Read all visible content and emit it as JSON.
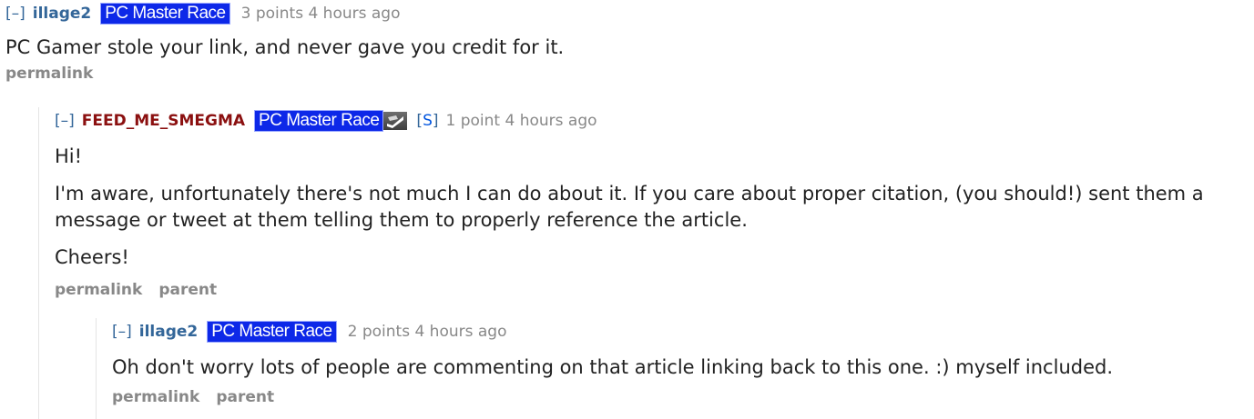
{
  "comments": [
    {
      "collapse": "[–]",
      "author": "illage2",
      "flair": "PC Master Race",
      "meta": "3 points 4 hours ago",
      "body": [
        "PC Gamer stole your link, and never gave you credit for it."
      ],
      "buttons": [
        "permalink"
      ]
    },
    {
      "collapse": "[–]",
      "author": "FEED_ME_SMEGMA",
      "flair": "PC Master Race",
      "submitter": {
        "open": "[",
        "label": "S",
        "close": "]"
      },
      "meta": "1 point 4 hours ago",
      "body": [
        "Hi!",
        "I'm aware, unfortunately there's not much I can do about it. If you care about proper citation, (you should!) sent them a message or tweet at them telling them to properly reference the article.",
        "Cheers!"
      ],
      "buttons": [
        "permalink",
        "parent"
      ]
    },
    {
      "collapse": "[–]",
      "author": "illage2",
      "flair": "PC Master Race",
      "meta": "2 points 4 hours ago",
      "body": [
        "Oh don't worry lots of people are commenting on that article linking back to this one. :) myself included."
      ],
      "buttons": [
        "permalink",
        "parent"
      ]
    }
  ],
  "icons": {
    "steam_badge": "steam-badge-icon"
  },
  "colors": {
    "author_link": "#336699",
    "submitter_author": "#8b1010",
    "flair_bg": "#0d28e8",
    "meta": "#888888"
  }
}
